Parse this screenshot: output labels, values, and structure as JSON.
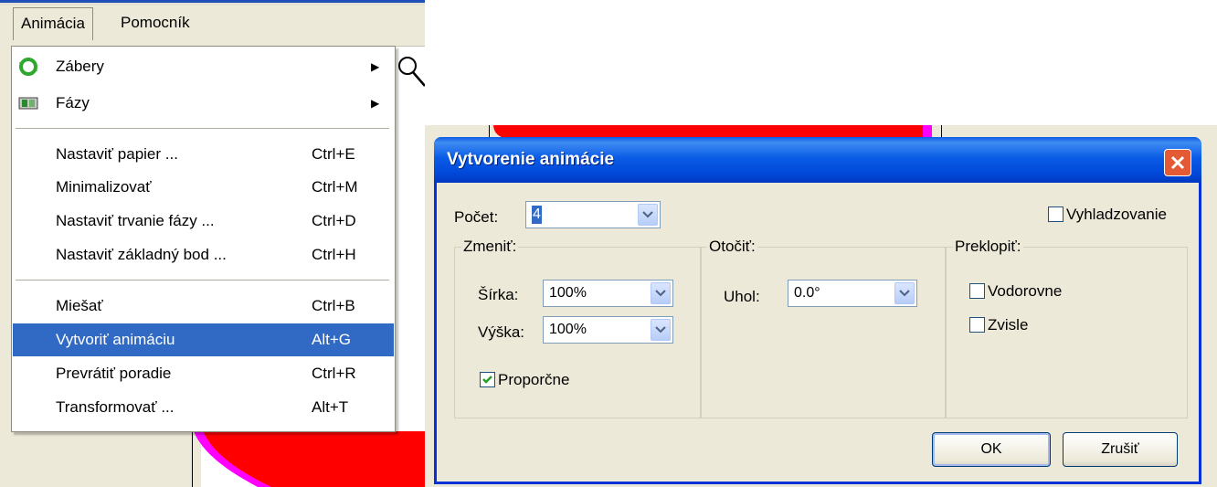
{
  "menubar": {
    "items": [
      "Animácia",
      "Pomocník"
    ]
  },
  "menu": {
    "items": [
      {
        "label": "Zábery",
        "shortcut": "",
        "submenu": true,
        "icon": "recycle-arrows-icon"
      },
      {
        "label": "Fázy",
        "shortcut": "",
        "submenu": true,
        "icon": "film-strip-icon"
      },
      {
        "label": "Nastaviť papier ...",
        "shortcut": "Ctrl+E"
      },
      {
        "label": "Minimalizovať",
        "shortcut": "Ctrl+M"
      },
      {
        "label": "Nastaviť trvanie fázy ...",
        "shortcut": "Ctrl+D"
      },
      {
        "label": "Nastaviť základný bod ...",
        "shortcut": "Ctrl+H"
      },
      {
        "label": "Miešať",
        "shortcut": "Ctrl+B"
      },
      {
        "label": "Vytvoriť animáciu",
        "shortcut": "Alt+G",
        "selected": true
      },
      {
        "label": "Prevrátiť poradie",
        "shortcut": "Ctrl+R"
      },
      {
        "label": "Transformovať ...",
        "shortcut": "Alt+T"
      }
    ]
  },
  "dialog": {
    "title": "Vytvorenie animácie",
    "count_label": "Počet:",
    "count_value": "4",
    "smoothing_label": "Vyhladzovanie",
    "smoothing_checked": false,
    "change": {
      "title": "Zmeniť:",
      "width_label": "Šírka:",
      "width_value": "100%",
      "height_label": "Výška:",
      "height_value": "100%",
      "proportional_label": "Proporčne",
      "proportional_checked": true
    },
    "rotate": {
      "title": "Otočiť:",
      "angle_label": "Uhol:",
      "angle_value": "0.0°"
    },
    "flip": {
      "title": "Preklopiť:",
      "horizontal_label": "Vodorovne",
      "vertical_label": "Zvisle"
    },
    "ok_label": "OK",
    "cancel_label": "Zrušiť"
  },
  "colors": {
    "accent": "#316ac5",
    "titlebar": "#0a5ce6",
    "canvas_fill": "#ff0000",
    "canvas_outline": "#ff00ff"
  }
}
